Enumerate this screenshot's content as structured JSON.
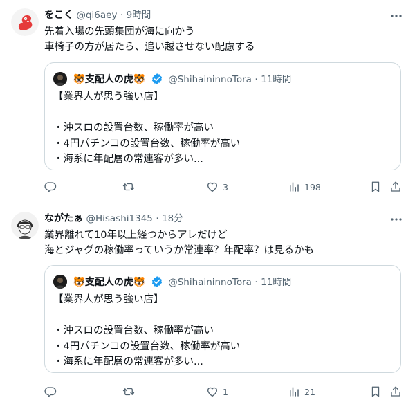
{
  "tweets": [
    {
      "author": {
        "name": "をこく",
        "handle": "@qi6aey",
        "time": "9時間"
      },
      "text": [
        "先着入場の先頭集団が海に向かう",
        "車椅子の方が居たら、追い越させない配慮する"
      ],
      "quote": {
        "name": "🐯支配人の虎🐯",
        "handle": "@ShihaininnoTora",
        "time": "11時間",
        "lines": [
          "【業界人が思う強い店】",
          "",
          "・沖スロの設置台数、稼働率が高い",
          "・4円パチンコの設置台数、稼働率が高い",
          "・海系に年配層の常連客が多い..."
        ]
      },
      "stats": {
        "likes": "3",
        "views": "198"
      }
    },
    {
      "author": {
        "name": "ながたぁ",
        "handle": "@Hisashi1345",
        "time": "18分"
      },
      "text": [
        "業界離れて10年以上経つからアレだけど",
        "海とジャグの稼働率っていうか常連率？年配率？は見るかも"
      ],
      "quote": {
        "name": "🐯支配人の虎🐯",
        "handle": "@ShihaininnoTora",
        "time": "11時間",
        "lines": [
          "【業界人が思う強い店】",
          "",
          "・沖スロの設置台数、稼働率が高い",
          "・4円パチンコの設置台数、稼働率が高い",
          "・海系に年配層の常連客が多い..."
        ]
      },
      "stats": {
        "likes": "1",
        "views": "21"
      }
    }
  ],
  "separator": "·",
  "colors": {
    "verified": "#1d9bf0",
    "secondary_text": "#536471",
    "border": "#cfd9de"
  },
  "icons": [
    "more-icon",
    "reply-icon",
    "retweet-icon",
    "like-icon",
    "views-icon",
    "bookmark-icon",
    "share-icon",
    "verified-badge-icon"
  ]
}
